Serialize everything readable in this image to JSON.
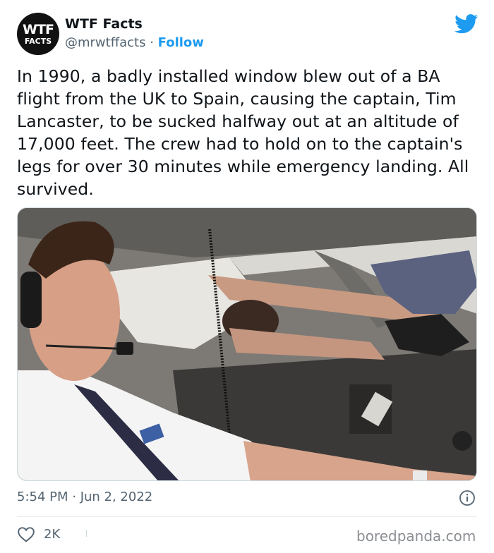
{
  "account": {
    "avatar_line1": "WTF",
    "avatar_line2": "FACTS",
    "name": "WTF Facts",
    "handle": "@mrwtffacts",
    "separator": " · ",
    "follow_label": "Follow"
  },
  "tweet": {
    "text": "In 1990, a badly installed window blew out of a BA flight from the UK to Spain, causing the captain, Tim Lancaster, to be sucked halfway out at an altitude of 17,000 feet. The crew had to hold on to the captain's legs for over 30 minutes while emergency landing. All survived.",
    "timestamp": "5:54 PM · Jun 2, 2022",
    "like_count": "2K"
  },
  "watermark": "boredpanda.com",
  "colors": {
    "accent": "#1d9bf0",
    "text": "#0f1419",
    "muted": "#536471"
  },
  "icons": [
    "twitter-bird-icon",
    "info-icon",
    "heart-icon"
  ]
}
